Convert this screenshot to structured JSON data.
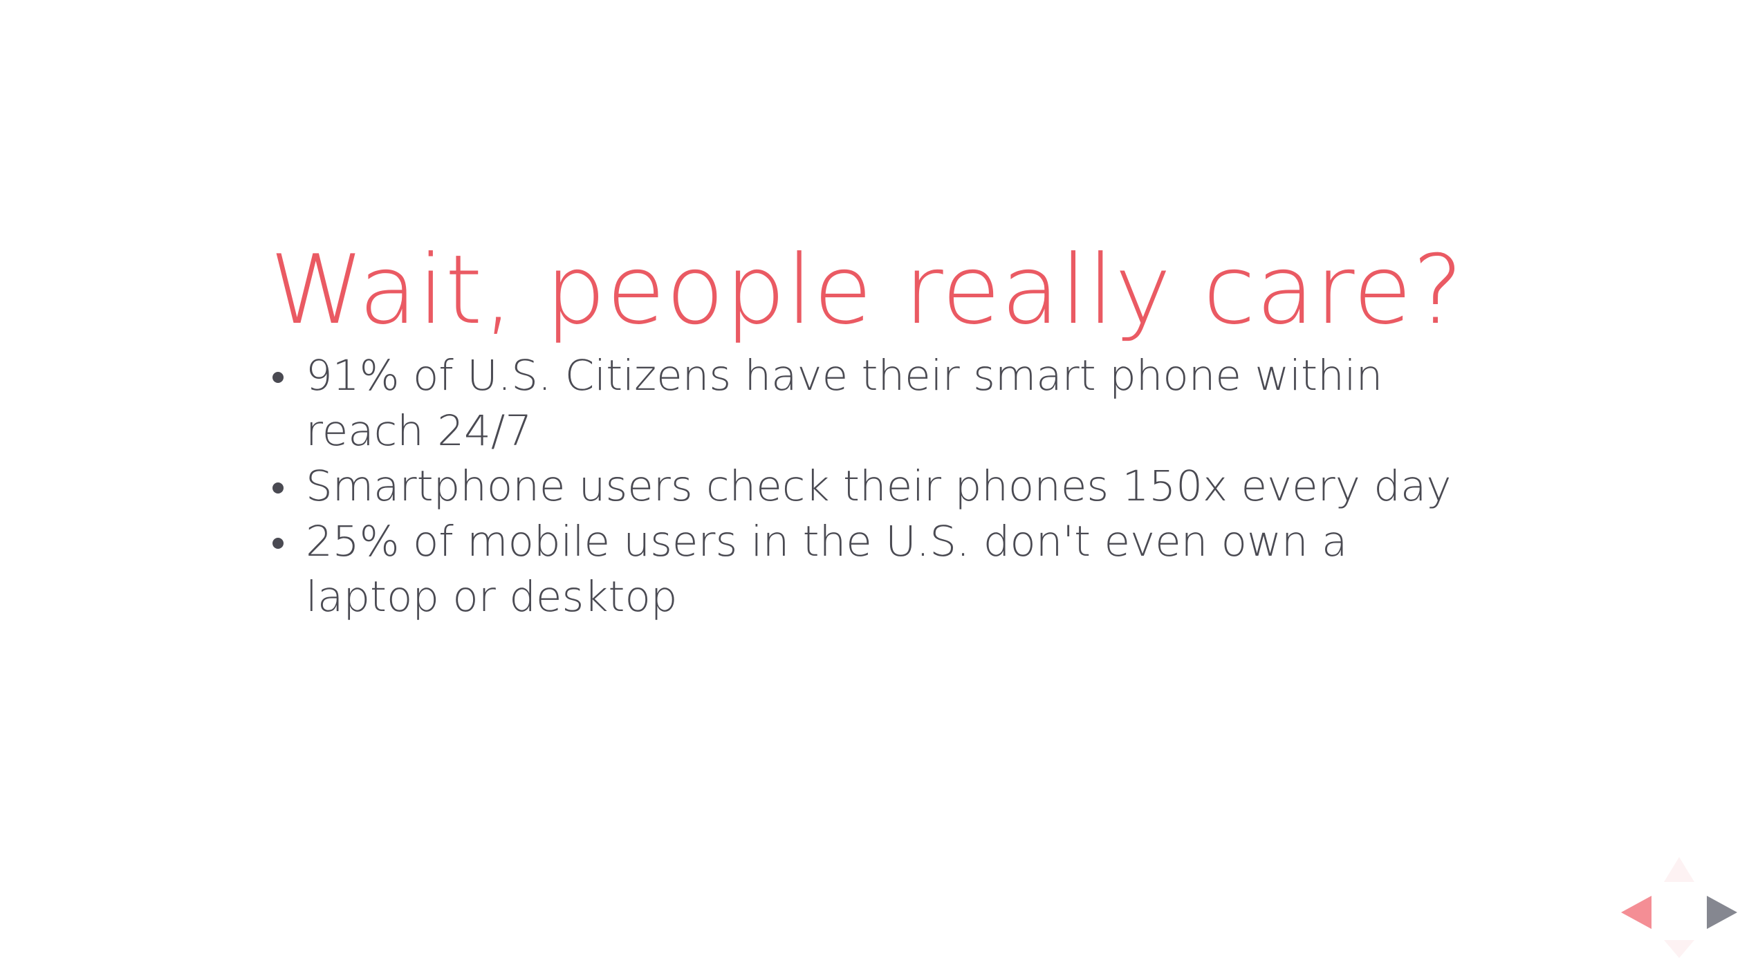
{
  "slide": {
    "title": "Wait, people really care?",
    "bullets": [
      "91% of U.S. Citizens have their smart phone within reach 24/7",
      "Smartphone users check their phones 150x every day",
      "25% of mobile users in the U.S. don't even own a laptop or desktop"
    ]
  },
  "navigation": {
    "up_icon": "arrow-up-icon",
    "down_icon": "arrow-down-icon",
    "left_icon": "arrow-left-icon",
    "right_icon": "arrow-right-icon"
  },
  "colors": {
    "title": "#ea5a63",
    "body_text": "#4a4a52",
    "nav_left": "#f48e95",
    "nav_right": "#858790",
    "nav_disabled": "#fdf2f3",
    "background": "#ffffff"
  }
}
